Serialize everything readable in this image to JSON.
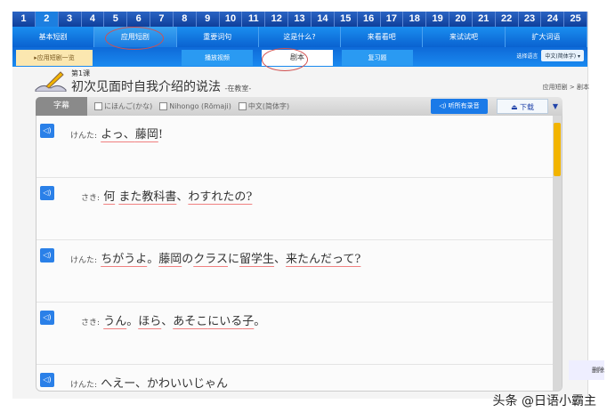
{
  "lesson_numbers": [
    "1",
    "2",
    "3",
    "4",
    "5",
    "6",
    "7",
    "8",
    "9",
    "10",
    "11",
    "12",
    "13",
    "14",
    "15",
    "16",
    "17",
    "18",
    "19",
    "20",
    "21",
    "22",
    "23",
    "24",
    "25"
  ],
  "tabs": [
    "基本短剧",
    "应用短剧",
    "重要词句",
    "这是什么?",
    "来看看吧",
    "来试试吧",
    "扩大词语"
  ],
  "subtabs": {
    "home": "▸应用短剧一览",
    "video": "播放视频",
    "script": "剧本",
    "practice": "复习题"
  },
  "language": {
    "label": "选择语言",
    "value": "中文(简体字)"
  },
  "header": {
    "lesson": "第1课",
    "title": "初次见面时自我介绍的说法",
    "subtitle": "-在教室-",
    "breadcrumb": "应用短剧 > 剧本"
  },
  "toolbar": {
    "subtitle_label": "字幕",
    "opt_kana": "にほんご(かな)",
    "opt_romaji": "Nihongo (Rōmaji)",
    "opt_chinese": "中文(简体字)",
    "listen_all": "听所有录音",
    "download": "下载"
  },
  "lines": [
    {
      "speaker": "けんた:",
      "parts": [
        "よっ、",
        "藤岡",
        "!"
      ]
    },
    {
      "speaker": "さき:",
      "parts": [
        "",
        "何",
        "",
        " ",
        "また教科書",
        "、",
        "わすれたの?"
      ]
    },
    {
      "speaker": "けんた:",
      "parts": [
        "",
        "ちがうよ",
        "。",
        "藤岡",
        "の",
        "クラス",
        "に",
        "留学生",
        "、",
        "来たんだって?"
      ]
    },
    {
      "speaker": "さき:",
      "parts": [
        "",
        "うん",
        "。",
        "ほら",
        "、",
        "あそこ",
        "にいる",
        "子",
        "。"
      ]
    },
    {
      "speaker": "けんた:",
      "parts": [
        "へえー、かわいいじゃん"
      ]
    }
  ],
  "side_button": "删除",
  "watermark": "头条 @日语小霸主"
}
